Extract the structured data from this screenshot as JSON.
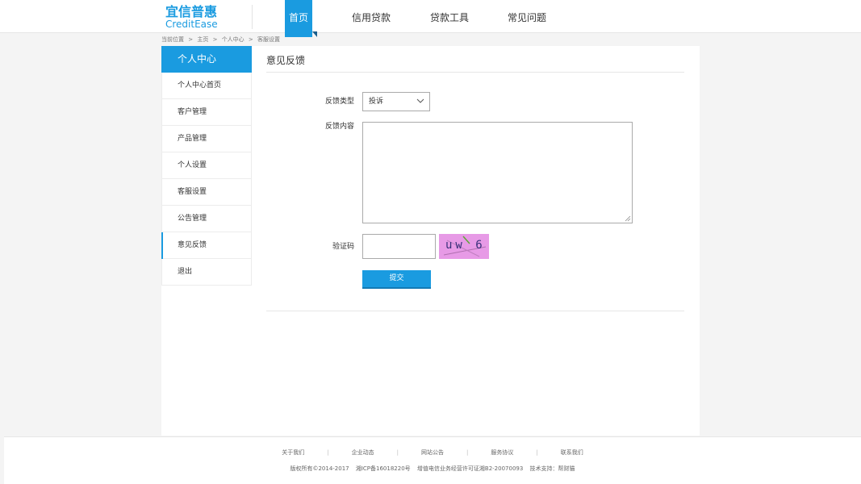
{
  "header": {
    "logo_cn": "宜信普惠",
    "logo_en": "CreditEase",
    "nav": [
      {
        "label": "首页",
        "active": true
      },
      {
        "label": "信用贷款",
        "active": false
      },
      {
        "label": "贷款工具",
        "active": false
      },
      {
        "label": "常见问题",
        "active": false
      }
    ]
  },
  "breadcrumb": [
    "当前位置",
    ">",
    "主页",
    ">",
    "个人中心",
    ">",
    "客服设置"
  ],
  "sidebar": {
    "title": "个人中心",
    "items": [
      {
        "label": "个人中心首页",
        "active": false
      },
      {
        "label": "客户管理",
        "active": false
      },
      {
        "label": "产品管理",
        "active": false
      },
      {
        "label": "个人设置",
        "active": false
      },
      {
        "label": "客服设置",
        "active": false
      },
      {
        "label": "公告管理",
        "active": false
      },
      {
        "label": "意见反馈",
        "active": true
      },
      {
        "label": "退出",
        "active": false
      }
    ]
  },
  "form": {
    "title": "意见反馈",
    "type_label": "反馈类型",
    "type_value": "投诉",
    "content_label": "反馈内容",
    "content_value": "",
    "captcha_label": "验证码",
    "captcha_value": "",
    "captcha_text": "uw 6",
    "submit_label": "提交"
  },
  "footer": {
    "links": [
      "关于我们",
      "企业动态",
      "网站公告",
      "服务协议",
      "联系我们"
    ],
    "copyright": "版权所有©2014-2017",
    "icp": "湘ICP备16018220号",
    "license": "增值电信业务经营许可证湘B2-20070093",
    "support": "技术支持：帮财猫"
  },
  "colors": {
    "accent": "#1a9be0",
    "captcha_bg": "#e79ae6"
  }
}
